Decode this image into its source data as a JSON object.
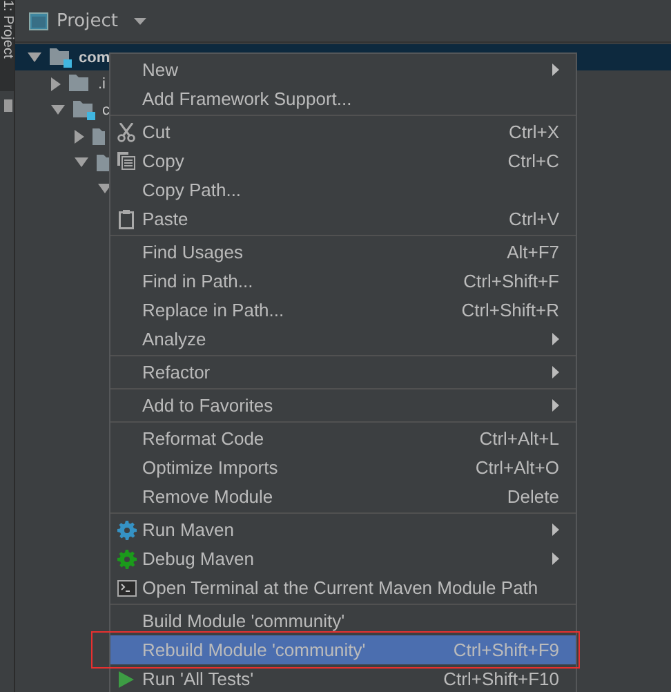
{
  "side_tab": {
    "label": "1: Project",
    "selected": true
  },
  "panel": {
    "title": "Project"
  },
  "tree": [
    {
      "label": "com",
      "expanded": true,
      "selected": true,
      "children": [
        {
          "label": ".i",
          "expanded": false,
          "selected": false
        },
        {
          "label": "c",
          "expanded": true,
          "selected": false,
          "children": [
            {
              "expanded": false,
              "selected": false
            },
            {
              "expanded": true,
              "selected": false,
              "children": [
                {
                  "expanded": true,
                  "selected": false
                }
              ]
            }
          ]
        }
      ]
    }
  ],
  "menu": [
    {
      "kind": "item",
      "label": "New",
      "submenu": true,
      "selected": false,
      "outlined": false
    },
    {
      "kind": "item",
      "label": "Add Framework Support...",
      "submenu": false,
      "selected": false,
      "outlined": false
    },
    {
      "kind": "separator"
    },
    {
      "kind": "item",
      "label": "Cut",
      "shortcut": "Ctrl+X",
      "submenu": false,
      "selected": false,
      "outlined": false
    },
    {
      "kind": "item",
      "label": "Copy",
      "shortcut": "Ctrl+C",
      "submenu": false,
      "selected": false,
      "outlined": false
    },
    {
      "kind": "item",
      "label": "Copy Path...",
      "submenu": false,
      "selected": false,
      "outlined": false
    },
    {
      "kind": "item",
      "label": "Paste",
      "shortcut": "Ctrl+V",
      "submenu": false,
      "selected": false,
      "outlined": false
    },
    {
      "kind": "separator"
    },
    {
      "kind": "item",
      "label": "Find Usages",
      "shortcut": "Alt+F7",
      "submenu": false,
      "selected": false,
      "outlined": false
    },
    {
      "kind": "item",
      "label": "Find in Path...",
      "shortcut": "Ctrl+Shift+F",
      "submenu": false,
      "selected": false,
      "outlined": false
    },
    {
      "kind": "item",
      "label": "Replace in Path...",
      "shortcut": "Ctrl+Shift+R",
      "submenu": false,
      "selected": false,
      "outlined": false
    },
    {
      "kind": "item",
      "label": "Analyze",
      "submenu": true,
      "selected": false,
      "outlined": false
    },
    {
      "kind": "separator"
    },
    {
      "kind": "item",
      "label": "Refactor",
      "submenu": true,
      "selected": false,
      "outlined": false
    },
    {
      "kind": "separator"
    },
    {
      "kind": "item",
      "label": "Add to Favorites",
      "submenu": true,
      "selected": false,
      "outlined": false
    },
    {
      "kind": "separator"
    },
    {
      "kind": "item",
      "label": "Reformat Code",
      "shortcut": "Ctrl+Alt+L",
      "submenu": false,
      "selected": false,
      "outlined": false
    },
    {
      "kind": "item",
      "label": "Optimize Imports",
      "shortcut": "Ctrl+Alt+O",
      "submenu": false,
      "selected": false,
      "outlined": false
    },
    {
      "kind": "item",
      "label": "Remove Module",
      "shortcut": "Delete",
      "submenu": false,
      "selected": false,
      "outlined": false
    },
    {
      "kind": "separator"
    },
    {
      "kind": "item",
      "label": "Run Maven",
      "submenu": true,
      "selected": false,
      "outlined": false
    },
    {
      "kind": "item",
      "label": "Debug Maven",
      "submenu": true,
      "selected": false,
      "outlined": false
    },
    {
      "kind": "item",
      "label": "Open Terminal at the Current Maven Module Path",
      "submenu": false,
      "selected": false,
      "outlined": false
    },
    {
      "kind": "separator"
    },
    {
      "kind": "item",
      "label": "Build Module 'community'",
      "submenu": false,
      "selected": false,
      "outlined": false
    },
    {
      "kind": "item",
      "label": "Rebuild Module 'community'",
      "shortcut": "Ctrl+Shift+F9",
      "submenu": false,
      "selected": true,
      "outlined": true
    },
    {
      "kind": "item",
      "label": "Run 'All Tests'",
      "shortcut": "Ctrl+Shift+F10",
      "submenu": false,
      "selected": false,
      "outlined": false
    }
  ]
}
